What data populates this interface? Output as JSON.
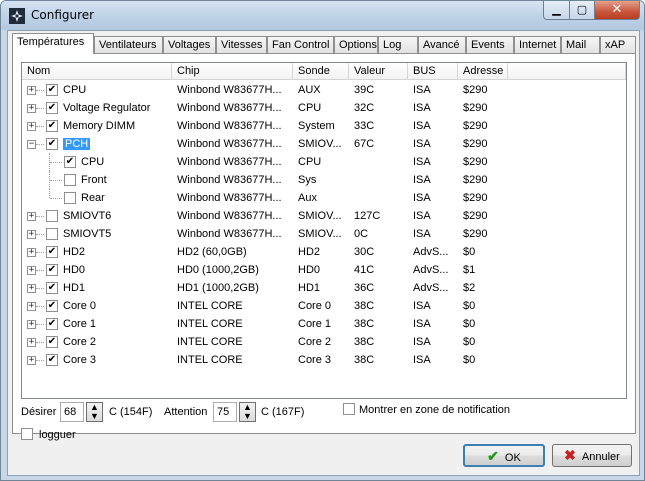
{
  "window": {
    "title": "Configurer"
  },
  "tabs": [
    {
      "label": "Températures",
      "active": true
    },
    {
      "label": "Ventilateurs"
    },
    {
      "label": "Voltages"
    },
    {
      "label": "Vitesses"
    },
    {
      "label": "Fan Control"
    },
    {
      "label": "Options"
    },
    {
      "label": "Log"
    },
    {
      "label": "Avancé"
    },
    {
      "label": "Events"
    },
    {
      "label": "Internet"
    },
    {
      "label": "Mail"
    },
    {
      "label": "xAP"
    }
  ],
  "table": {
    "columns": [
      "Nom",
      "Chip",
      "Sonde",
      "Valeur",
      "BUS",
      "Adresse"
    ],
    "rows": [
      {
        "nom": "CPU",
        "chip": "Winbond W83677H...",
        "sonde": "AUX",
        "valeur": "39C",
        "bus": "ISA",
        "adresse": "$290",
        "checked": true,
        "level": 0,
        "expander": "+"
      },
      {
        "nom": "Voltage Regulator",
        "chip": "Winbond W83677H...",
        "sonde": "CPU",
        "valeur": "32C",
        "bus": "ISA",
        "adresse": "$290",
        "checked": true,
        "level": 0,
        "expander": "+"
      },
      {
        "nom": "Memory DIMM",
        "chip": "Winbond W83677H...",
        "sonde": "System",
        "valeur": "33C",
        "bus": "ISA",
        "adresse": "$290",
        "checked": true,
        "level": 0,
        "expander": "+"
      },
      {
        "nom": "PCH",
        "chip": "Winbond W83677H...",
        "sonde": "SMIOV...",
        "valeur": "67C",
        "bus": "ISA",
        "adresse": "$290",
        "checked": true,
        "level": 0,
        "expander": "−",
        "selected": true
      },
      {
        "nom": "CPU",
        "chip": "Winbond W83677H...",
        "sonde": "CPU",
        "valeur": "",
        "bus": "ISA",
        "adresse": "$290",
        "checked": true,
        "level": 1
      },
      {
        "nom": "Front",
        "chip": "Winbond W83677H...",
        "sonde": "Sys",
        "valeur": "",
        "bus": "ISA",
        "adresse": "$290",
        "checked": false,
        "level": 1
      },
      {
        "nom": "Rear",
        "chip": "Winbond W83677H...",
        "sonde": "Aux",
        "valeur": "",
        "bus": "ISA",
        "adresse": "$290",
        "checked": false,
        "level": 1
      },
      {
        "nom": "SMIOVT6",
        "chip": "Winbond W83677H...",
        "sonde": "SMIOV...",
        "valeur": "127C",
        "bus": "ISA",
        "adresse": "$290",
        "checked": false,
        "level": 0,
        "expander": "+"
      },
      {
        "nom": "SMIOVT5",
        "chip": "Winbond W83677H...",
        "sonde": "SMIOV...",
        "valeur": "0C",
        "bus": "ISA",
        "adresse": "$290",
        "checked": false,
        "level": 0,
        "expander": "+"
      },
      {
        "nom": "HD2",
        "chip": "HD2 (60,0GB)",
        "sonde": "HD2",
        "valeur": "30C",
        "bus": "AdvS...",
        "adresse": "$0",
        "checked": true,
        "level": 0,
        "expander": "+"
      },
      {
        "nom": "HD0",
        "chip": "HD0 (1000,2GB)",
        "sonde": "HD0",
        "valeur": "41C",
        "bus": "AdvS...",
        "adresse": "$1",
        "checked": true,
        "level": 0,
        "expander": "+"
      },
      {
        "nom": "HD1",
        "chip": "HD1 (1000,2GB)",
        "sonde": "HD1",
        "valeur": "36C",
        "bus": "AdvS...",
        "adresse": "$2",
        "checked": true,
        "level": 0,
        "expander": "+"
      },
      {
        "nom": "Core 0",
        "chip": "INTEL CORE",
        "sonde": "Core 0",
        "valeur": "38C",
        "bus": "ISA",
        "adresse": "$0",
        "checked": true,
        "level": 0,
        "expander": "+"
      },
      {
        "nom": "Core 1",
        "chip": "INTEL CORE",
        "sonde": "Core 1",
        "valeur": "38C",
        "bus": "ISA",
        "adresse": "$0",
        "checked": true,
        "level": 0,
        "expander": "+"
      },
      {
        "nom": "Core 2",
        "chip": "INTEL CORE",
        "sonde": "Core 2",
        "valeur": "38C",
        "bus": "ISA",
        "adresse": "$0",
        "checked": true,
        "level": 0,
        "expander": "+"
      },
      {
        "nom": "Core 3",
        "chip": "INTEL CORE",
        "sonde": "Core 3",
        "valeur": "38C",
        "bus": "ISA",
        "adresse": "$0",
        "checked": true,
        "level": 0,
        "expander": "+"
      }
    ]
  },
  "settings": {
    "desirer_label": "Désirer",
    "desirer_value": "68",
    "desirer_unit": "C (154F)",
    "attention_label": "Attention",
    "attention_value": "75",
    "attention_unit": "C (167F)",
    "notification_label": "Montrer en zone de notification",
    "notification_checked": false,
    "logguer_label": "logguer",
    "logguer_checked": false
  },
  "buttons": {
    "ok_label": "OK",
    "cancel_label": "Annuler"
  },
  "colors": {
    "selection": "#3399ff",
    "ok_check": "#1f9a1f",
    "cancel_x": "#c8201e"
  }
}
